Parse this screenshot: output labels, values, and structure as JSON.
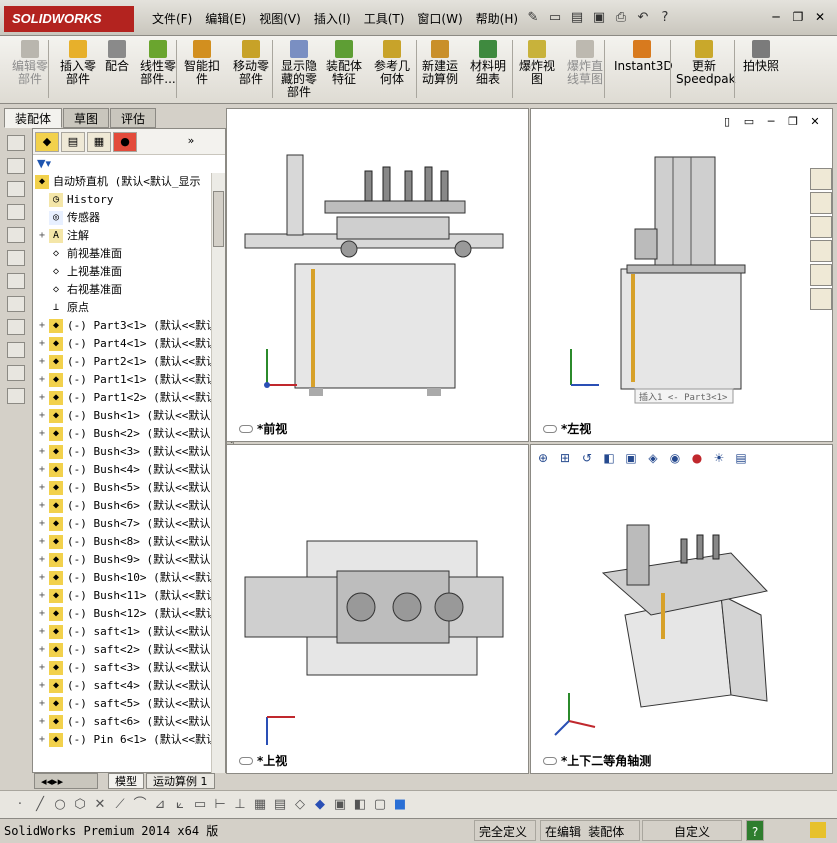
{
  "app": {
    "logo_text": "SOLIDWORKS"
  },
  "menu": [
    "文件(F)",
    "编辑(E)",
    "视图(V)",
    "插入(I)",
    "工具(T)",
    "窗口(W)",
    "帮助(H)"
  ],
  "ribbon": [
    {
      "label": "编辑零\n部件",
      "disabled": true,
      "icon": "edit-part-icon",
      "color": "#b9b6ae"
    },
    {
      "label": "插入零\n部件",
      "disabled": false,
      "icon": "insert-component-icon",
      "color": "#e7b02b"
    },
    {
      "label": "配合",
      "disabled": false,
      "icon": "mate-icon",
      "color": "#8a8a8a"
    },
    {
      "label": "线性零\n部件...",
      "disabled": false,
      "icon": "linear-pattern-icon",
      "color": "#6aa52e"
    },
    {
      "label": "智能扣\n件",
      "disabled": false,
      "icon": "smart-fasteners-icon",
      "color": "#d28f1f"
    },
    {
      "label": "移动零\n部件",
      "disabled": false,
      "icon": "move-component-icon",
      "color": "#c7a228"
    },
    {
      "label": "显示隐\n藏的零\n部件",
      "disabled": false,
      "icon": "show-hidden-icon",
      "color": "#7a8fc2"
    },
    {
      "label": "装配体\n特征",
      "disabled": false,
      "icon": "assembly-feature-icon",
      "color": "#5e9e34"
    },
    {
      "label": "参考几\n何体",
      "disabled": false,
      "icon": "reference-geometry-icon",
      "color": "#c8a32a"
    },
    {
      "label": "新建运\n动算例",
      "disabled": false,
      "icon": "motion-study-icon",
      "color": "#c98f2a"
    },
    {
      "label": "材料明\n细表",
      "disabled": false,
      "icon": "bom-icon",
      "color": "#3f8a3f"
    },
    {
      "label": "爆炸视\n图",
      "disabled": false,
      "icon": "exploded-view-icon",
      "color": "#c8b23b"
    },
    {
      "label": "爆炸直\n线草图",
      "disabled": true,
      "icon": "explode-line-icon",
      "color": "#bdb9b0"
    },
    {
      "label": "Instant3D",
      "disabled": false,
      "icon": "instant3d-icon",
      "color": "#d87a1e"
    },
    {
      "label": "更新\nSpeedpak",
      "disabled": false,
      "icon": "speedpak-icon",
      "color": "#c9a82b"
    },
    {
      "label": "拍快照",
      "disabled": false,
      "icon": "snapshot-icon",
      "color": "#7b7b7b"
    }
  ],
  "panel_tabs": [
    "装配体",
    "草图",
    "评估"
  ],
  "tree": {
    "root": "自动矫直机  (默认<默认_显示",
    "items": [
      {
        "text": "History",
        "expand": false,
        "icon": "history-icon"
      },
      {
        "text": "传感器",
        "expand": false,
        "icon": "sensor-icon"
      },
      {
        "text": "注解",
        "expand": true,
        "icon": "annotation-icon"
      },
      {
        "text": "前视基准面",
        "expand": false,
        "icon": "plane-icon"
      },
      {
        "text": "上视基准面",
        "expand": false,
        "icon": "plane-icon"
      },
      {
        "text": "右视基准面",
        "expand": false,
        "icon": "plane-icon"
      },
      {
        "text": "原点",
        "expand": false,
        "icon": "origin-icon"
      },
      {
        "text": "(-) Part3<1> (默认<<默认",
        "expand": true,
        "icon": "part-icon"
      },
      {
        "text": "(-) Part4<1> (默认<<默认",
        "expand": true,
        "icon": "part-icon"
      },
      {
        "text": "(-) Part2<1> (默认<<默认",
        "expand": true,
        "icon": "part-icon"
      },
      {
        "text": "(-) Part1<1> (默认<<默认",
        "expand": true,
        "icon": "part-icon"
      },
      {
        "text": "(-) Part1<2> (默认<<默认",
        "expand": true,
        "icon": "part-icon"
      },
      {
        "text": "(-) Bush<1>  (默认<<默认",
        "expand": true,
        "icon": "part-icon"
      },
      {
        "text": "(-) Bush<2>  (默认<<默认",
        "expand": true,
        "icon": "part-icon"
      },
      {
        "text": "(-) Bush<3>  (默认<<默认",
        "expand": true,
        "icon": "part-icon"
      },
      {
        "text": "(-) Bush<4>  (默认<<默认",
        "expand": true,
        "icon": "part-icon"
      },
      {
        "text": "(-) Bush<5>  (默认<<默认",
        "expand": true,
        "icon": "part-icon"
      },
      {
        "text": "(-) Bush<6>  (默认<<默认",
        "expand": true,
        "icon": "part-icon"
      },
      {
        "text": "(-) Bush<7>  (默认<<默认",
        "expand": true,
        "icon": "part-icon"
      },
      {
        "text": "(-) Bush<8>  (默认<<默认",
        "expand": true,
        "icon": "part-icon"
      },
      {
        "text": "(-) Bush<9>  (默认<<默认",
        "expand": true,
        "icon": "part-icon"
      },
      {
        "text": "(-) Bush<10> (默认<<默认",
        "expand": true,
        "icon": "part-icon"
      },
      {
        "text": "(-) Bush<11> (默认<<默认",
        "expand": true,
        "icon": "part-icon"
      },
      {
        "text": "(-) Bush<12> (默认<<默认",
        "expand": true,
        "icon": "part-icon"
      },
      {
        "text": "(-) saft<1>  (默认<<默认",
        "expand": true,
        "icon": "part-icon"
      },
      {
        "text": "(-) saft<2>  (默认<<默认",
        "expand": true,
        "icon": "part-icon"
      },
      {
        "text": "(-) saft<3>  (默认<<默认",
        "expand": true,
        "icon": "part-icon"
      },
      {
        "text": "(-) saft<4>  (默认<<默认",
        "expand": true,
        "icon": "part-icon"
      },
      {
        "text": "(-) saft<5>  (默认<<默认",
        "expand": true,
        "icon": "part-icon"
      },
      {
        "text": "(-) saft<6>  (默认<<默认",
        "expand": true,
        "icon": "part-icon"
      },
      {
        "text": "(-) Pin 6<1> (默认<<默认",
        "expand": true,
        "icon": "part-icon"
      }
    ]
  },
  "bottom_tabs": [
    "模型",
    "运动算例 1"
  ],
  "viewports": {
    "front": "*前视",
    "left": "*左视",
    "top": "*上视",
    "iso": "*上下二等角轴测"
  },
  "tooltip": "插入1 <- Part3<1>",
  "status": {
    "product": "SolidWorks Premium 2014 x64 版",
    "defined": "完全定义",
    "editing": "在编辑 装配体",
    "units": "自定义",
    "help": "?"
  }
}
